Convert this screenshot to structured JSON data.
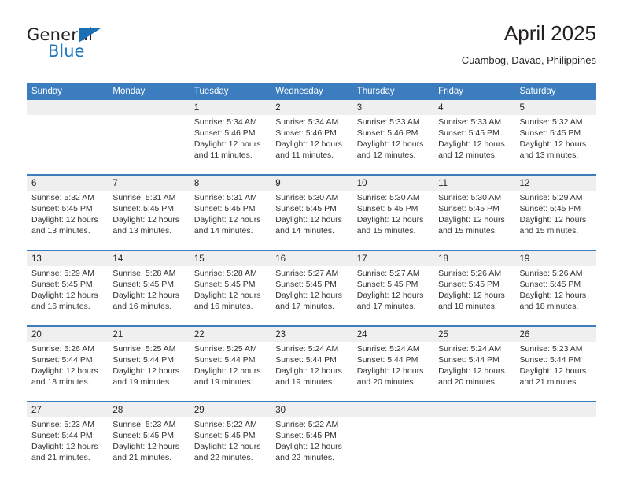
{
  "logo": {
    "word_top": "General",
    "word_bottom": "Blue",
    "triangle_color": "#1b6fb3",
    "blue_color": "#1b7ac4"
  },
  "header": {
    "title": "April 2025",
    "subtitle": "Cuambog, Davao, Philippines"
  },
  "theme": {
    "header_blue": "#3b7dbf",
    "daynum_band": "#efefef",
    "text": "#231f20"
  },
  "weekday_headers": [
    "Sunday",
    "Monday",
    "Tuesday",
    "Wednesday",
    "Thursday",
    "Friday",
    "Saturday"
  ],
  "weeks": [
    [
      {
        "day": "",
        "sunrise": "",
        "sunset": "",
        "daylight": ""
      },
      {
        "day": "",
        "sunrise": "",
        "sunset": "",
        "daylight": ""
      },
      {
        "day": "1",
        "sunrise": "Sunrise: 5:34 AM",
        "sunset": "Sunset: 5:46 PM",
        "daylight": "Daylight: 12 hours and 11 minutes."
      },
      {
        "day": "2",
        "sunrise": "Sunrise: 5:34 AM",
        "sunset": "Sunset: 5:46 PM",
        "daylight": "Daylight: 12 hours and 11 minutes."
      },
      {
        "day": "3",
        "sunrise": "Sunrise: 5:33 AM",
        "sunset": "Sunset: 5:46 PM",
        "daylight": "Daylight: 12 hours and 12 minutes."
      },
      {
        "day": "4",
        "sunrise": "Sunrise: 5:33 AM",
        "sunset": "Sunset: 5:45 PM",
        "daylight": "Daylight: 12 hours and 12 minutes."
      },
      {
        "day": "5",
        "sunrise": "Sunrise: 5:32 AM",
        "sunset": "Sunset: 5:45 PM",
        "daylight": "Daylight: 12 hours and 13 minutes."
      }
    ],
    [
      {
        "day": "6",
        "sunrise": "Sunrise: 5:32 AM",
        "sunset": "Sunset: 5:45 PM",
        "daylight": "Daylight: 12 hours and 13 minutes."
      },
      {
        "day": "7",
        "sunrise": "Sunrise: 5:31 AM",
        "sunset": "Sunset: 5:45 PM",
        "daylight": "Daylight: 12 hours and 13 minutes."
      },
      {
        "day": "8",
        "sunrise": "Sunrise: 5:31 AM",
        "sunset": "Sunset: 5:45 PM",
        "daylight": "Daylight: 12 hours and 14 minutes."
      },
      {
        "day": "9",
        "sunrise": "Sunrise: 5:30 AM",
        "sunset": "Sunset: 5:45 PM",
        "daylight": "Daylight: 12 hours and 14 minutes."
      },
      {
        "day": "10",
        "sunrise": "Sunrise: 5:30 AM",
        "sunset": "Sunset: 5:45 PM",
        "daylight": "Daylight: 12 hours and 15 minutes."
      },
      {
        "day": "11",
        "sunrise": "Sunrise: 5:30 AM",
        "sunset": "Sunset: 5:45 PM",
        "daylight": "Daylight: 12 hours and 15 minutes."
      },
      {
        "day": "12",
        "sunrise": "Sunrise: 5:29 AM",
        "sunset": "Sunset: 5:45 PM",
        "daylight": "Daylight: 12 hours and 15 minutes."
      }
    ],
    [
      {
        "day": "13",
        "sunrise": "Sunrise: 5:29 AM",
        "sunset": "Sunset: 5:45 PM",
        "daylight": "Daylight: 12 hours and 16 minutes."
      },
      {
        "day": "14",
        "sunrise": "Sunrise: 5:28 AM",
        "sunset": "Sunset: 5:45 PM",
        "daylight": "Daylight: 12 hours and 16 minutes."
      },
      {
        "day": "15",
        "sunrise": "Sunrise: 5:28 AM",
        "sunset": "Sunset: 5:45 PM",
        "daylight": "Daylight: 12 hours and 16 minutes."
      },
      {
        "day": "16",
        "sunrise": "Sunrise: 5:27 AM",
        "sunset": "Sunset: 5:45 PM",
        "daylight": "Daylight: 12 hours and 17 minutes."
      },
      {
        "day": "17",
        "sunrise": "Sunrise: 5:27 AM",
        "sunset": "Sunset: 5:45 PM",
        "daylight": "Daylight: 12 hours and 17 minutes."
      },
      {
        "day": "18",
        "sunrise": "Sunrise: 5:26 AM",
        "sunset": "Sunset: 5:45 PM",
        "daylight": "Daylight: 12 hours and 18 minutes."
      },
      {
        "day": "19",
        "sunrise": "Sunrise: 5:26 AM",
        "sunset": "Sunset: 5:45 PM",
        "daylight": "Daylight: 12 hours and 18 minutes."
      }
    ],
    [
      {
        "day": "20",
        "sunrise": "Sunrise: 5:26 AM",
        "sunset": "Sunset: 5:44 PM",
        "daylight": "Daylight: 12 hours and 18 minutes."
      },
      {
        "day": "21",
        "sunrise": "Sunrise: 5:25 AM",
        "sunset": "Sunset: 5:44 PM",
        "daylight": "Daylight: 12 hours and 19 minutes."
      },
      {
        "day": "22",
        "sunrise": "Sunrise: 5:25 AM",
        "sunset": "Sunset: 5:44 PM",
        "daylight": "Daylight: 12 hours and 19 minutes."
      },
      {
        "day": "23",
        "sunrise": "Sunrise: 5:24 AM",
        "sunset": "Sunset: 5:44 PM",
        "daylight": "Daylight: 12 hours and 19 minutes."
      },
      {
        "day": "24",
        "sunrise": "Sunrise: 5:24 AM",
        "sunset": "Sunset: 5:44 PM",
        "daylight": "Daylight: 12 hours and 20 minutes."
      },
      {
        "day": "25",
        "sunrise": "Sunrise: 5:24 AM",
        "sunset": "Sunset: 5:44 PM",
        "daylight": "Daylight: 12 hours and 20 minutes."
      },
      {
        "day": "26",
        "sunrise": "Sunrise: 5:23 AM",
        "sunset": "Sunset: 5:44 PM",
        "daylight": "Daylight: 12 hours and 21 minutes."
      }
    ],
    [
      {
        "day": "27",
        "sunrise": "Sunrise: 5:23 AM",
        "sunset": "Sunset: 5:44 PM",
        "daylight": "Daylight: 12 hours and 21 minutes."
      },
      {
        "day": "28",
        "sunrise": "Sunrise: 5:23 AM",
        "sunset": "Sunset: 5:45 PM",
        "daylight": "Daylight: 12 hours and 21 minutes."
      },
      {
        "day": "29",
        "sunrise": "Sunrise: 5:22 AM",
        "sunset": "Sunset: 5:45 PM",
        "daylight": "Daylight: 12 hours and 22 minutes."
      },
      {
        "day": "30",
        "sunrise": "Sunrise: 5:22 AM",
        "sunset": "Sunset: 5:45 PM",
        "daylight": "Daylight: 12 hours and 22 minutes."
      },
      {
        "day": "",
        "sunrise": "",
        "sunset": "",
        "daylight": ""
      },
      {
        "day": "",
        "sunrise": "",
        "sunset": "",
        "daylight": ""
      },
      {
        "day": "",
        "sunrise": "",
        "sunset": "",
        "daylight": ""
      }
    ]
  ]
}
